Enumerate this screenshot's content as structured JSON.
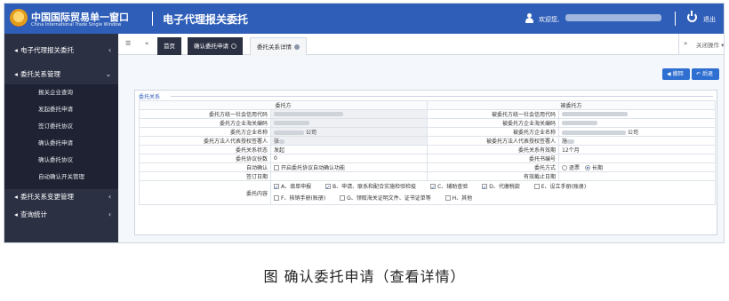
{
  "header": {
    "logo_cn": "中国国际贸易单一窗口",
    "logo_en": "China International Trade Single Window",
    "app_title": "电子代理报关委托",
    "welcome": "欢迎您,",
    "logout": "退出"
  },
  "sidebar": {
    "top": {
      "label": "电子代理报关委托",
      "icon": "◂"
    },
    "group": {
      "label": "委托关系管理"
    },
    "items": [
      "报关企业查询",
      "发起委托申请",
      "签订委托协议",
      "确认委托申请",
      "确认委托协议",
      "自动确认开关管理"
    ],
    "bottom": [
      {
        "label": "委托关系变更管理"
      },
      {
        "label": "查询统计"
      }
    ]
  },
  "tabbar": {
    "home": "首页",
    "tab1": "确认委托申请",
    "tab2": "委托关系详情",
    "close_ops": "关闭操作"
  },
  "toolbar": {
    "return_label": "撤回",
    "back_label": "后退"
  },
  "panel": {
    "title": "委托关系",
    "left_header": "委托方",
    "right_header": "被委托方",
    "rows": [
      {
        "l_label": "委托方统一社会信用代码",
        "l_value": "",
        "r_label": "被委托方统一社会信用代码",
        "r_value": ""
      },
      {
        "l_label": "委托方企业海关编码",
        "l_value": "",
        "r_label": "被委托方企业海关编码",
        "r_value": ""
      },
      {
        "l_label": "委托方企业名称",
        "l_value": "公司",
        "r_label": "被委托方企业名称",
        "r_value": "公司"
      },
      {
        "l_label": "委托方法人代表授权签署人",
        "l_value": "张",
        "r_label": "被委托方法人代表授权签署人",
        "r_value": "施"
      },
      {
        "l_label": "委托关系状态",
        "l_value": "发起",
        "r_label": "委托关系有效期",
        "r_value": "12个月"
      },
      {
        "l_label": "委托协议份数",
        "l_value": "0",
        "r_label": "委托书编号",
        "r_value": ""
      }
    ],
    "auto_confirm_label": "自动确认",
    "auto_confirm_text": "开启委托协议自动确认功能",
    "method_label": "委托方式",
    "method_options": [
      "逐票",
      "长期"
    ],
    "sign_date_label": "签订日期",
    "valid_end_label": "有效截止日期",
    "content_label": "委托内容",
    "content_options_row1": [
      "A、填单申报",
      "B、申请、联系和配合实施检验检疫",
      "C、辅助查验",
      "D、代缴税款",
      "E、设立手册(账册)"
    ],
    "content_options_row2": [
      "F、核销手册(账册)",
      "G、领取海关证明文件、证书证单等",
      "H、其他"
    ]
  },
  "caption": "图  确认委托申请（查看详情）"
}
